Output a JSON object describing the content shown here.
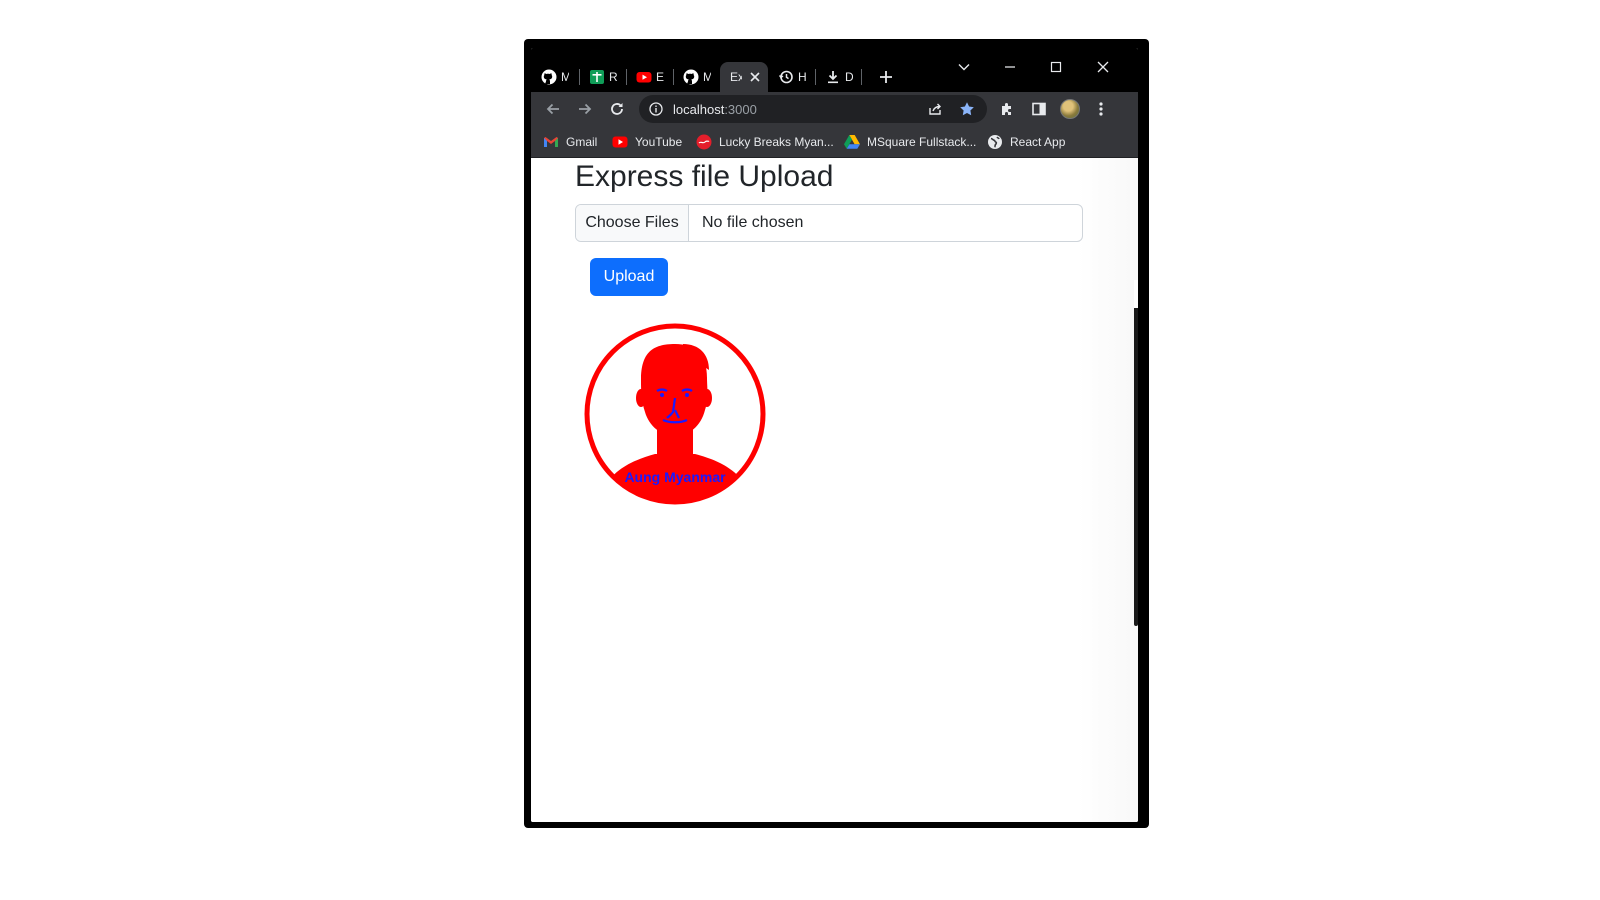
{
  "browser": {
    "tabs": [
      {
        "icon": "github-icon",
        "title": "M"
      },
      {
        "icon": "sheets-icon",
        "title": "R"
      },
      {
        "icon": "youtube-icon",
        "title": "E"
      },
      {
        "icon": "github-icon",
        "title": "M"
      },
      {
        "icon": "page-icon",
        "title": "Ex",
        "active": true
      },
      {
        "icon": "history-icon",
        "title": "H"
      },
      {
        "icon": "download-icon",
        "title": "D"
      }
    ],
    "url_host": "localhost",
    "url_port": ":3000",
    "bookmarks": [
      {
        "icon": "gmail-icon",
        "label": "Gmail"
      },
      {
        "icon": "youtube-icon",
        "label": "YouTube"
      },
      {
        "icon": "cocacola-icon",
        "label": "Lucky Breaks Myan..."
      },
      {
        "icon": "google-drive-icon",
        "label": "MSquare Fullstack..."
      },
      {
        "icon": "globe-icon",
        "label": "React App"
      }
    ]
  },
  "page": {
    "title": "Express file Upload",
    "file_input": {
      "button_label": "Choose Files",
      "status": "No file chosen"
    },
    "upload_label": "Upload",
    "avatar_caption": "Aung Myanmar"
  },
  "colors": {
    "primary": "#0d6efd",
    "avatar_red": "#ff0000",
    "avatar_blue": "#1a1aff",
    "chrome_dark": "#35363a"
  }
}
